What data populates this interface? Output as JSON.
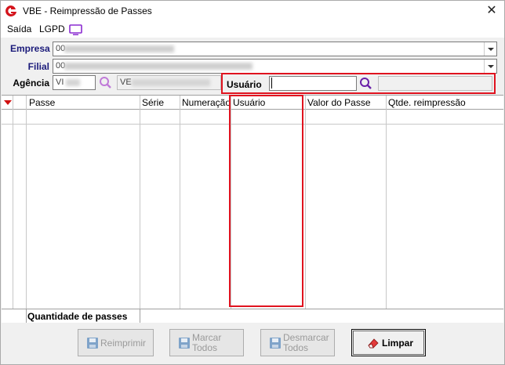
{
  "window": {
    "title": "VBE - Reimpressão de Passes",
    "close_glyph": "✕"
  },
  "menu": {
    "items": [
      "Saída",
      "LGPD"
    ]
  },
  "form": {
    "empresa_label": "Empresa",
    "empresa_value": "00",
    "filial_label": "Filial",
    "filial_value": "00",
    "agencia_label": "Agência",
    "agencia_code": "VI",
    "agencia_desc": "VE",
    "usuario_label": "Usuário",
    "usuario_value": ""
  },
  "grid": {
    "columns": [
      "Passe",
      "Série",
      "Numeração",
      "Usuário",
      "Valor do Passe",
      "Qtde. reimpressão"
    ],
    "rows": [],
    "footer_label": "Quantidade de passes"
  },
  "buttons": {
    "reimprimir": "Reimprimir",
    "marcar_line1": "Marcar",
    "marcar_line2": "Todos",
    "desmarcar_line1": "Desmarcar",
    "desmarcar_line2": "Todos",
    "limpar": "Limpar"
  },
  "colors": {
    "highlight": "#e0131f",
    "label": "#1a1a7a",
    "search_icon": "#7b2fbe"
  },
  "icons": [
    "app-logo-icon",
    "close-icon",
    "tv-icon",
    "chevron-down-icon",
    "search-icon",
    "sort-triangle-icon",
    "floppy-icon",
    "eraser-icon"
  ]
}
